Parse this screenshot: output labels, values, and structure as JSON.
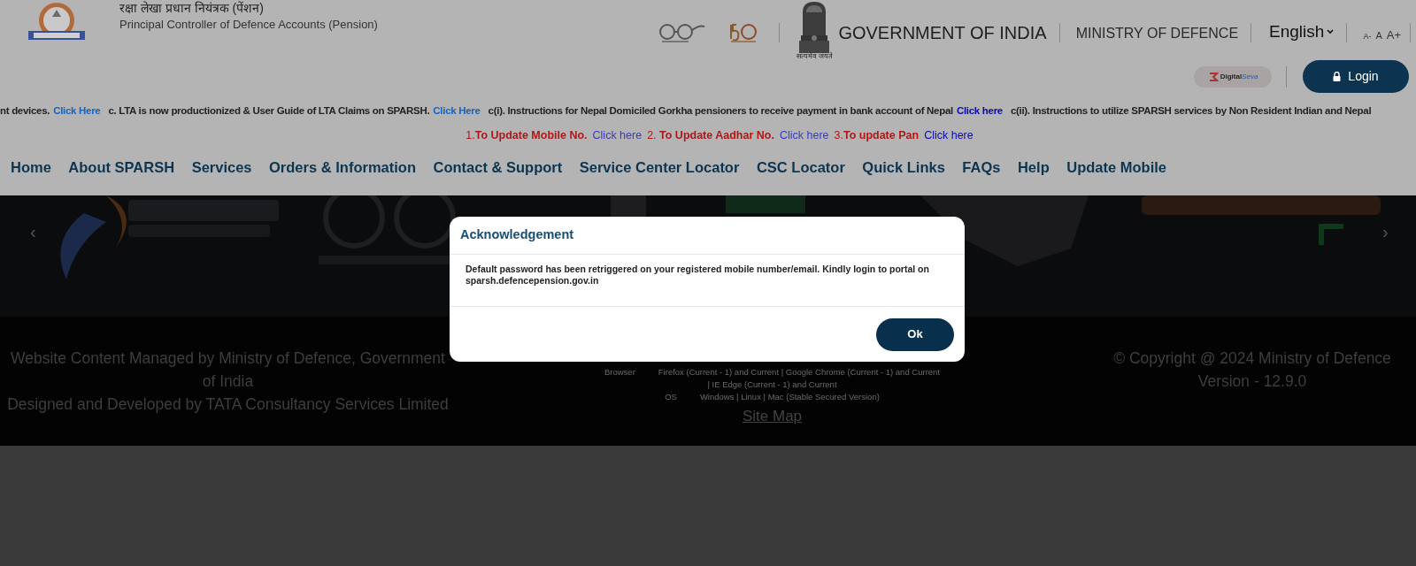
{
  "header": {
    "org_hindi": "रक्षा लेखा प्रधान नियंत्रक (पेंशन)",
    "org_english": "Principal Controller of Defence Accounts (Pension)",
    "emblem_motto": "सत्यमेव जयते",
    "government": "GOVERNMENT OF INDIA",
    "ministry": "MINISTRY OF DEFENCE",
    "language": "English",
    "font_sizes": [
      "A-",
      "A",
      "A+"
    ],
    "digital_seva": {
      "part_1": "Digital",
      "part_2": "Seva"
    },
    "login": "Login"
  },
  "ticker": [
    {
      "text": "nt devices.",
      "link": "Click Here",
      "color": "#1565c0"
    },
    {
      "text": "c. LTA is now productionized & User Guide of LTA Claims on SPARSH.",
      "link": "Click Here",
      "color": "#1565c0"
    },
    {
      "text": "c(i). Instructions for Nepal Domiciled Gorkha pensioners to receive payment in bank account of Nepal",
      "link": "Click here",
      "color": "#0a0ab0"
    },
    {
      "text": "c(ii). Instructions to utilize SPARSH services by Non Resident Indian and Nepal"
    }
  ],
  "updates": [
    {
      "text": "1.**To Update Mobile No.**",
      "link": "Click here",
      "color": "#3b3bc0"
    },
    {
      "text": "2. **To Update Aadhar No.**",
      "link": "Click here",
      "color": "#3b3bc0"
    },
    {
      "text": "3.**To update Pan**",
      "link": "Click here",
      "color": "#0a0ab0"
    }
  ],
  "nav": [
    "Home",
    "About SPARSH",
    "Services",
    "Orders & Information",
    "Contact & Support",
    "Service Center Locator",
    "CSC Locator",
    "Quick Links",
    "FAQs",
    "Help",
    "Update Mobile"
  ],
  "carousel": {
    "prev": "‹",
    "next": "›"
  },
  "footer": {
    "left": [
      "Website Content Managed by Ministry of Defence, Government of India",
      "Designed and Developed by TATA Consultancy Services Limited"
    ],
    "support": [
      {
        "label": "Browser",
        "value": "Firefox (Current - 1) and Current | Google Chrome (Current - 1) and Current"
      },
      {
        "value": "| IE Edge (Current - 1) and Current"
      },
      {
        "label": "OS",
        "value": "Windows | Linux | Mac (Stable Secured Version)"
      }
    ],
    "site_map": "Site Map",
    "right": [
      "© Copyright @ 2024 Ministry of Defence",
      "Version - 12.9.0"
    ]
  },
  "dialog": {
    "title": "Acknowledgement",
    "message": "Default password has been retriggered on your registered mobile number/email. Kindly login to portal on sparsh.defencepension.gov.in",
    "button": "Ok"
  }
}
